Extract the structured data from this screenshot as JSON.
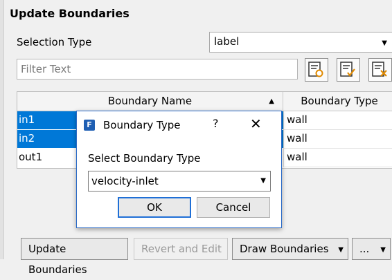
{
  "panel": {
    "title": "Update Boundaries"
  },
  "selection": {
    "label": "Selection Type",
    "value": "label"
  },
  "filter": {
    "placeholder": "Filter Text"
  },
  "toolbar": {
    "icons": [
      "select-all-icon",
      "select-visible-icon",
      "deselect-icon"
    ]
  },
  "table": {
    "headers": [
      "Boundary Name",
      "Boundary Type"
    ],
    "rows": [
      {
        "name": "in1",
        "type": "wall",
        "selected": true
      },
      {
        "name": "in2",
        "type": "wall",
        "selected": true
      },
      {
        "name": "out1",
        "type": "wall",
        "selected": false
      }
    ]
  },
  "dialog": {
    "title": "Boundary Type",
    "help": "?",
    "close": "✕",
    "prompt": "Select Boundary Type",
    "value": "velocity-inlet",
    "ok": "OK",
    "cancel": "Cancel"
  },
  "footer": {
    "update": "Update Boundaries",
    "revert": "Revert and Edit",
    "draw": "Draw Boundaries",
    "more": "..."
  },
  "colors": {
    "selection": "#0078d7",
    "accent": "#1f6fd6"
  }
}
